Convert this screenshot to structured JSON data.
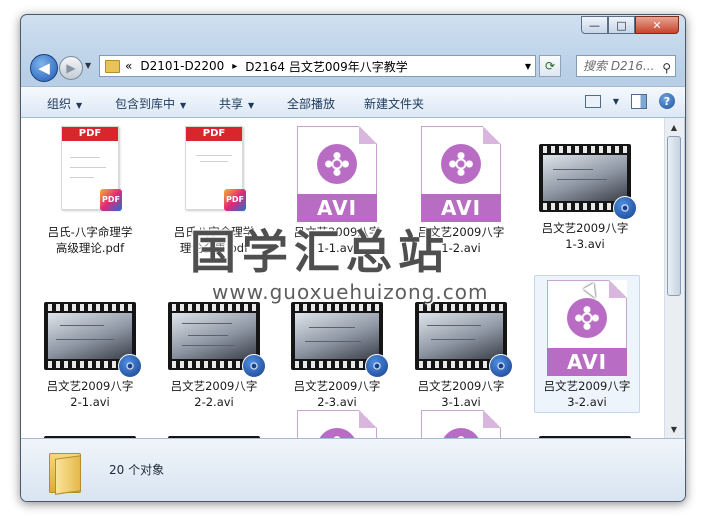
{
  "window": {
    "caption_buttons": {
      "minimize": "—",
      "maximize": "□",
      "close": "✕"
    }
  },
  "nav": {
    "back_icon": "◀",
    "forward_icon": "▶",
    "address": {
      "prefix": "«",
      "crumb1": "D2101-D2200",
      "separator": "▸",
      "crumb2": "D2164 吕文艺009年八字教学",
      "drop": "▼"
    },
    "refresh_icon": "⟳",
    "search_placeholder": "搜索 D216...",
    "search_icon": "⚲"
  },
  "toolbar": {
    "organize": "组织",
    "include_library": "包含到库中",
    "share": "共享",
    "play_all": "全部播放",
    "new_folder": "新建文件夹",
    "dropdown_arrow": "▼",
    "help": "?"
  },
  "files": [
    {
      "type": "pdf",
      "line1": "吕氏-八字命理学",
      "line2": "高级理论.pdf",
      "badge": "PDF",
      "band": "PDF"
    },
    {
      "type": "pdf",
      "line1": "吕氏八字命理学",
      "line2": "理论全集.pdf",
      "badge": "PDF",
      "band": "PDF"
    },
    {
      "type": "avi",
      "line1": "吕文艺2009八字",
      "line2": "1-1.avi",
      "band": "AVI"
    },
    {
      "type": "avi",
      "line1": "吕文艺2009八字",
      "line2": "1-2.avi",
      "band": "AVI"
    },
    {
      "type": "video",
      "line1": "吕文艺2009八字",
      "line2": "1-3.avi"
    },
    {
      "type": "video",
      "line1": "吕文艺2009八字",
      "line2": "2-1.avi"
    },
    {
      "type": "video",
      "line1": "吕文艺2009八字",
      "line2": "2-2.avi"
    },
    {
      "type": "video",
      "line1": "吕文艺2009八字",
      "line2": "2-3.avi"
    },
    {
      "type": "video",
      "line1": "吕文艺2009八字",
      "line2": "3-1.avi"
    },
    {
      "type": "avi",
      "line1": "吕文艺2009八字",
      "line2": "3-2.avi",
      "band": "AVI"
    }
  ],
  "watermark": {
    "text": "国学汇总站",
    "url": "www.guoxuehuizong.com"
  },
  "status": {
    "count": "20 个对象"
  },
  "scrollbar": {
    "up": "▲",
    "down": "▼"
  }
}
